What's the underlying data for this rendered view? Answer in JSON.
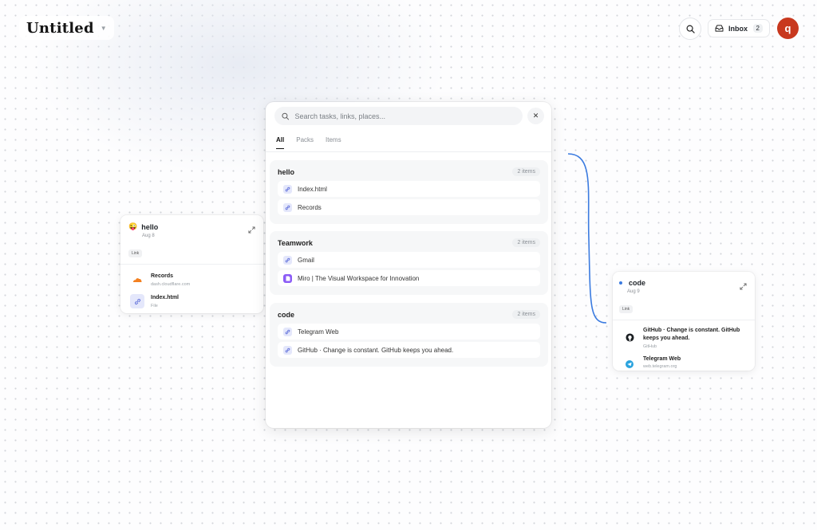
{
  "header": {
    "title": "Untitled",
    "inbox_label": "Inbox",
    "inbox_count": "2",
    "avatar_letter": "q"
  },
  "colors": {
    "accent": "#3b7be0",
    "avatar": "#c8381e",
    "connector": "#3b7be0"
  },
  "search": {
    "placeholder": "Search tasks, links, places...",
    "close_label": "✕",
    "tabs": [
      {
        "label": "All",
        "active": true
      },
      {
        "label": "Packs",
        "active": false
      },
      {
        "label": "Items",
        "active": false
      }
    ],
    "groups": [
      {
        "name": "hello",
        "count": "2 items",
        "items": [
          {
            "label": "Index.html",
            "icon": "link-icon"
          },
          {
            "label": "Records",
            "icon": "link-icon"
          }
        ]
      },
      {
        "name": "Teamwork",
        "count": "2 items",
        "items": [
          {
            "label": "Gmail",
            "icon": "link-icon"
          },
          {
            "label": "Miro | The Visual Workspace for Innovation",
            "icon": "file-icon"
          }
        ]
      },
      {
        "name": "code",
        "count": "2 items",
        "items": [
          {
            "label": "Telegram Web",
            "icon": "link-icon"
          },
          {
            "label": "GitHub · Change is constant. GitHub keeps you ahead.",
            "icon": "link-icon"
          }
        ]
      }
    ]
  },
  "hello_card": {
    "emoji": "😜",
    "title": "hello",
    "date": "Aug 8",
    "tag": "Link",
    "rows": [
      {
        "title": "Records",
        "subtitle": "dash.cloudflare.com",
        "icon": "cloudflare-icon"
      },
      {
        "title": "Index.html",
        "subtitle": "File",
        "icon": "link-icon"
      }
    ]
  },
  "code_card": {
    "title": "code",
    "date": "Aug 9",
    "tag": "Link",
    "rows": [
      {
        "title": "GitHub · Change is constant. GitHub keeps you ahead.",
        "subtitle": "GitHub",
        "icon": "github-icon"
      },
      {
        "title": "Telegram Web",
        "subtitle": "web.telegram.org",
        "icon": "telegram-icon"
      }
    ]
  }
}
